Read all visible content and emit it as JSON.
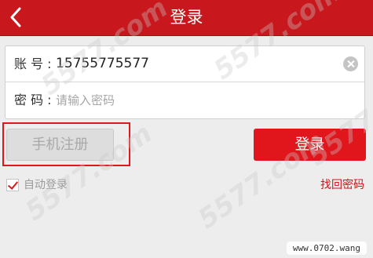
{
  "header": {
    "title": "登录",
    "back_icon": "chevron-left-icon"
  },
  "form": {
    "account": {
      "label": "账 号 :",
      "value": "15755775577"
    },
    "password": {
      "label": "密 码 :",
      "placeholder": "请输入密码"
    }
  },
  "buttons": {
    "register_label": "手机注册",
    "login_label": "登录"
  },
  "options": {
    "auto_login_label": "自动登录",
    "auto_login_checked": true,
    "forgot_password_label": "找回密码"
  },
  "watermarks": {
    "repeated_mark": "5577.com",
    "site": "www.0702.wang"
  },
  "colors": {
    "header_red": "#c8181d",
    "accent_red": "#e1161c",
    "background": "#ededed"
  }
}
